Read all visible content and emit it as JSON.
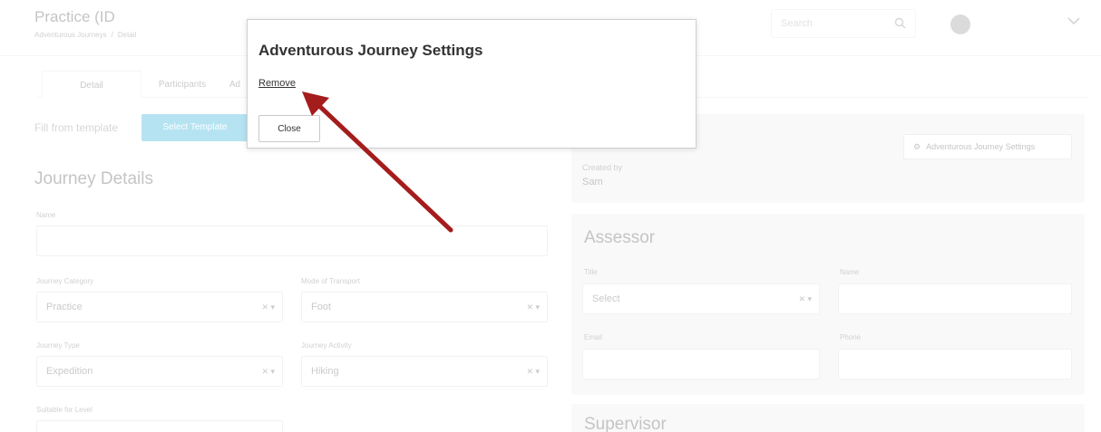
{
  "header": {
    "title": "Practice (ID",
    "breadcrumb": [
      "Adventurous Journeys",
      "Detail"
    ],
    "search_placeholder": "Search"
  },
  "tabs": [
    "Detail",
    "Participants",
    "Ad"
  ],
  "template": {
    "fill_label": "Fill from template",
    "select_button": "Select Template"
  },
  "journey_details": {
    "title": "Journey Details",
    "name_label": "Name",
    "category_label": "Journey Category",
    "category_value": "Practice",
    "transport_label": "Mode of Transport",
    "transport_value": "Foot",
    "type_label": "Journey Type",
    "type_value": "Expedition",
    "activity_label": "Journey Activity",
    "activity_value": "Hiking",
    "level_label": "Suitable for Level"
  },
  "right_panel": {
    "settings_button": "Adventurous Journey Settings",
    "created_by_label": "Created by",
    "created_by_value": "Sam"
  },
  "assessor": {
    "title": "Assessor",
    "title_label": "Title",
    "title_placeholder": "Select",
    "name_label": "Name",
    "email_label": "Email",
    "phone_label": "Phone"
  },
  "supervisor": {
    "title": "Supervisor"
  },
  "modal": {
    "title": "Adventurous Journey Settings",
    "remove_link": "Remove",
    "close_button": "Close"
  },
  "colors": {
    "accent_blue": "#2bb0d7",
    "arrow_red": "#a51c1c"
  }
}
